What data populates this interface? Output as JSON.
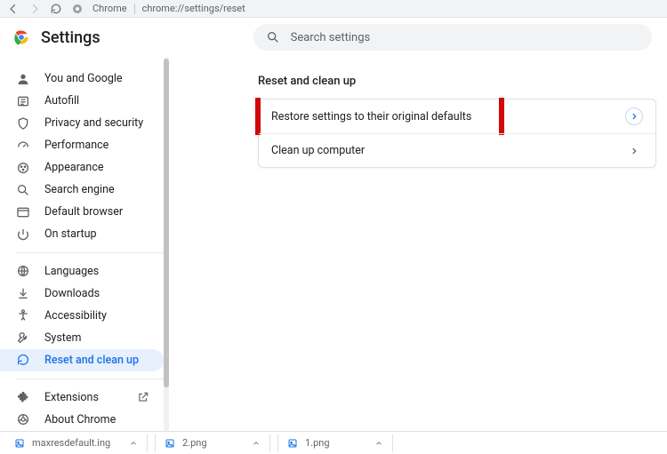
{
  "toolbar": {
    "browser_label": "Chrome",
    "url": "chrome://settings/reset"
  },
  "header": {
    "title": "Settings",
    "search_placeholder": "Search settings"
  },
  "sidebar": {
    "group1": [
      {
        "label": "You and Google"
      },
      {
        "label": "Autofill"
      },
      {
        "label": "Privacy and security"
      },
      {
        "label": "Performance"
      },
      {
        "label": "Appearance"
      },
      {
        "label": "Search engine"
      },
      {
        "label": "Default browser"
      },
      {
        "label": "On startup"
      }
    ],
    "group2": [
      {
        "label": "Languages"
      },
      {
        "label": "Downloads"
      },
      {
        "label": "Accessibility"
      },
      {
        "label": "System"
      },
      {
        "label": "Reset and clean up"
      }
    ],
    "group3": [
      {
        "label": "Extensions"
      },
      {
        "label": "About Chrome"
      }
    ]
  },
  "main": {
    "section_title": "Reset and clean up",
    "rows": [
      {
        "label": "Restore settings to their original defaults"
      },
      {
        "label": "Clean up computer"
      }
    ]
  },
  "shelf": {
    "items": [
      {
        "label": "maxresdefault.ing"
      },
      {
        "label": "2.png"
      },
      {
        "label": "1.png"
      }
    ]
  }
}
